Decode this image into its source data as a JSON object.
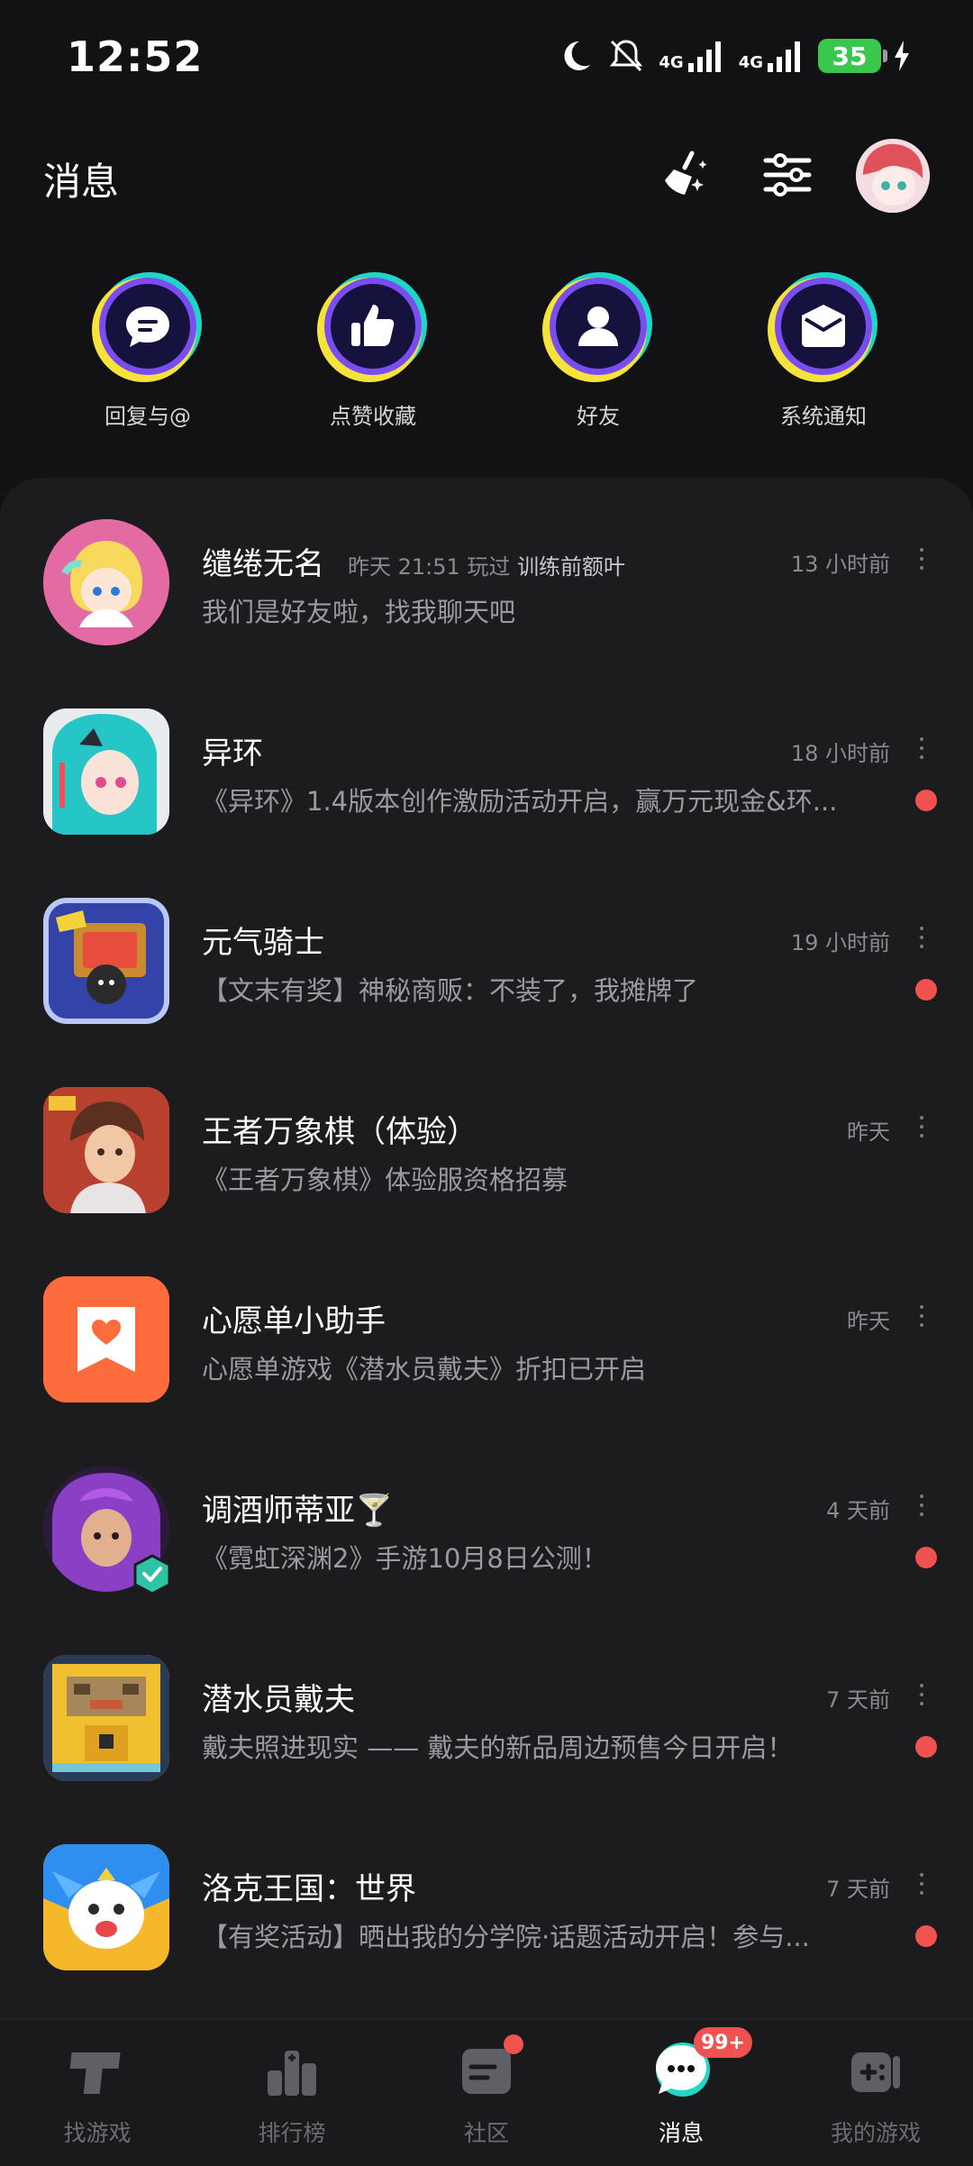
{
  "status_bar": {
    "time": "12:52",
    "network_1": "4G",
    "network_2": "4G",
    "battery": "35"
  },
  "header": {
    "title": "消息"
  },
  "quick_actions": [
    {
      "label": "回复与@",
      "icon": "chat-bubble-icon"
    },
    {
      "label": "点赞收藏",
      "icon": "thumbs-up-icon"
    },
    {
      "label": "好友",
      "icon": "person-icon"
    },
    {
      "label": "系统通知",
      "icon": "envelope-icon"
    }
  ],
  "messages": [
    {
      "name": "缱绻无名",
      "meta_prefix": "昨天 21:51 玩过",
      "meta_game": "训练前额叶",
      "time": "13 小时前",
      "preview": "我们是好友啦，找我聊天吧",
      "unread": false
    },
    {
      "name": "异环",
      "time": "18 小时前",
      "preview": "《异环》1.4版本创作激励活动开启，赢万元现金&环...",
      "unread": true
    },
    {
      "name": "元气骑士",
      "time": "19 小时前",
      "preview": "【文末有奖】神秘商贩：不装了，我摊牌了",
      "unread": true
    },
    {
      "name": "王者万象棋（体验）",
      "time": "昨天",
      "preview": "《王者万象棋》体验服资格招募",
      "unread": false
    },
    {
      "name": "心愿单小助手",
      "time": "昨天",
      "preview": "心愿单游戏《潜水员戴夫》折扣已开启",
      "unread": false
    },
    {
      "name": "调酒师蒂亚🍸",
      "time": "4 天前",
      "preview": "《霓虹深渊2》手游10月8日公测！",
      "unread": true
    },
    {
      "name": "潜水员戴夫",
      "time": "7 天前",
      "preview": "戴夫照进现实 —— 戴夫的新品周边预售今日开启！",
      "unread": true
    },
    {
      "name": "洛克王国：世界",
      "time": "7 天前",
      "preview": "【有奖活动】晒出我的分学院·话题活动开启！参与...",
      "unread": true
    }
  ],
  "tabs": [
    {
      "label": "找游戏"
    },
    {
      "label": "排行榜"
    },
    {
      "label": "社区"
    },
    {
      "label": "消息",
      "badge": "99+"
    },
    {
      "label": "我的游戏"
    }
  ]
}
